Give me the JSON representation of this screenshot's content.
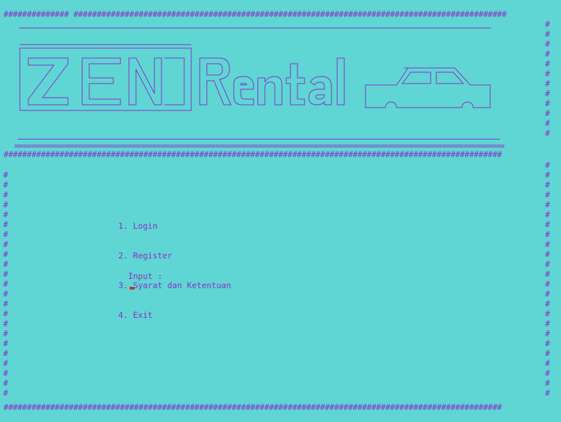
{
  "frame": {
    "hash_char": "#",
    "equals_char": "="
  },
  "banner": {
    "logo_text": "ZEN",
    "brand_text": "Rental"
  },
  "menu": {
    "items": [
      {
        "label": "1. Login"
      },
      {
        "label": "2. Register"
      },
      {
        "label": "3. Syarat dan Ketentuan"
      },
      {
        "label": "4. Exit"
      }
    ]
  },
  "prompt": {
    "label": "Input :"
  },
  "colors": {
    "background": "#5fd6d4",
    "text": "#8b2fc9",
    "cursor": "#c0392b"
  }
}
